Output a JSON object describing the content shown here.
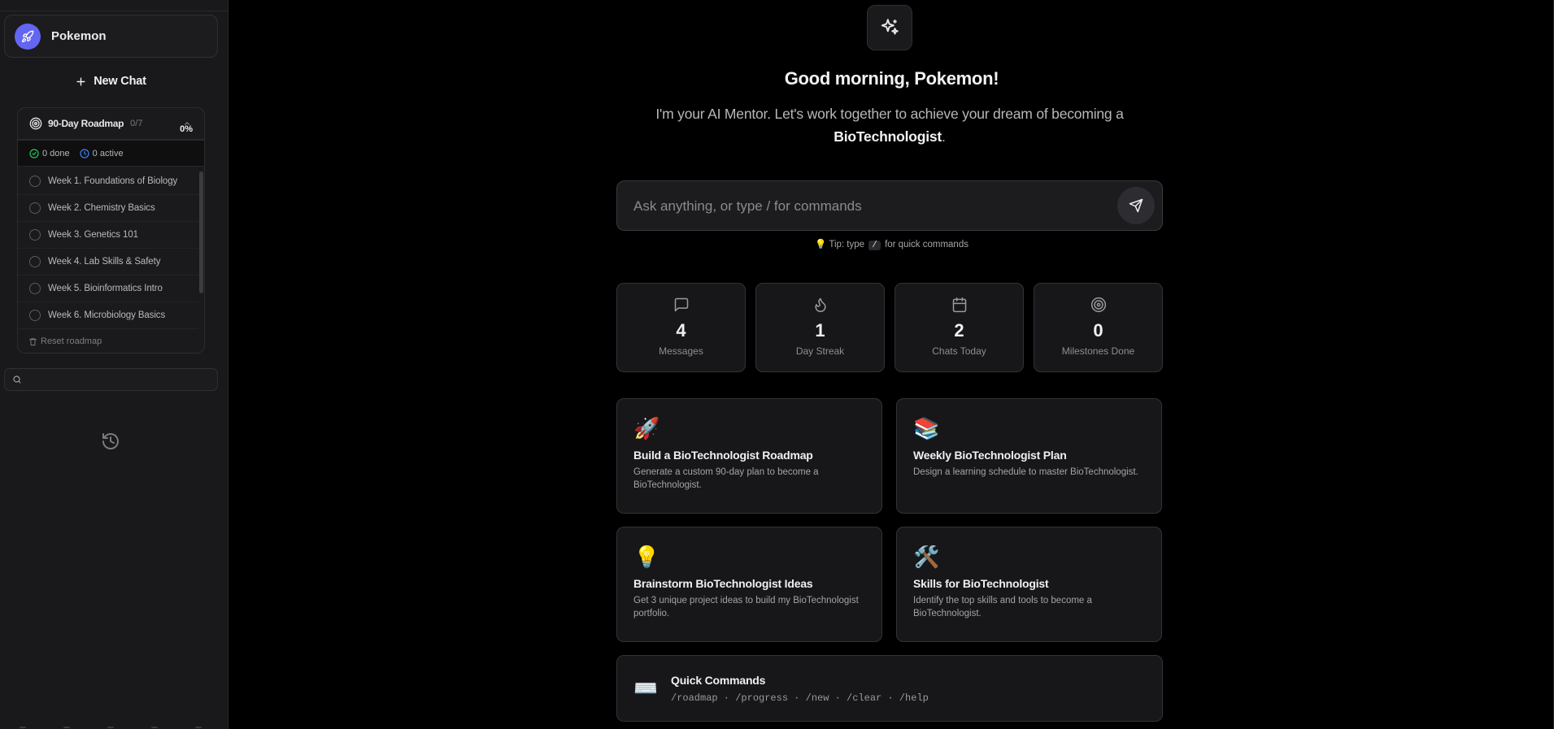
{
  "user": {
    "name": "Pokemon"
  },
  "sidebar": {
    "new_chat_label": "New Chat",
    "roadmap": {
      "title": "90-Day Roadmap",
      "count": "0/7",
      "done": "0 done",
      "active": "0 active",
      "percent": "0%",
      "weeks": [
        "Week 1. Foundations of Biology",
        "Week 2. Chemistry Basics",
        "Week 3. Genetics 101",
        "Week 4. Lab Skills & Safety",
        "Week 5. Bioinformatics Intro",
        "Week 6. Microbiology Basics"
      ],
      "reset_label": "Reset roadmap"
    },
    "search": {
      "value": "",
      "placeholder": ""
    }
  },
  "main": {
    "greeting": "Good morning, Pokemon!",
    "intro_prefix": "I'm your AI Mentor. Let's work together to achieve your dream of becoming a",
    "intro_goal": "BioTechnologist",
    "intro_suffix": ".",
    "composer": {
      "placeholder": "Ask anything, or type / for commands",
      "value": ""
    },
    "tip": {
      "bulb": "💡",
      "prefix": "Tip: type",
      "key": "/",
      "suffix": "for quick commands"
    },
    "stats": [
      {
        "icon": "message-icon",
        "value": "4",
        "label": "Messages"
      },
      {
        "icon": "flame-icon",
        "value": "1",
        "label": "Day Streak"
      },
      {
        "icon": "calendar-icon",
        "value": "2",
        "label": "Chats Today"
      },
      {
        "icon": "target-icon",
        "value": "0",
        "label": "Milestones Done"
      }
    ],
    "cards": [
      {
        "emoji": "🚀",
        "title": "Build a BioTechnologist Roadmap",
        "desc": "Generate a custom 90-day plan to become a BioTechnologist."
      },
      {
        "emoji": "📚",
        "title": "Weekly BioTechnologist Plan",
        "desc": "Design a learning schedule to master BioTechnologist."
      },
      {
        "emoji": "💡",
        "title": "Brainstorm BioTechnologist Ideas",
        "desc": "Get 3 unique project ideas to build my BioTechnologist portfolio."
      },
      {
        "emoji": "🛠️",
        "title": "Skills for BioTechnologist",
        "desc": "Identify the top skills and tools to become a BioTechnologist."
      }
    ],
    "quick_commands": {
      "emoji": "⌨️",
      "title": "Quick Commands",
      "commands": "/roadmap · /progress · /new · /clear · /help"
    }
  },
  "colors": {
    "accent": "#6366f1",
    "done_green": "#22c55e",
    "active_blue": "#3b82f6",
    "background": "#000000",
    "sidebar": "#19191b"
  }
}
